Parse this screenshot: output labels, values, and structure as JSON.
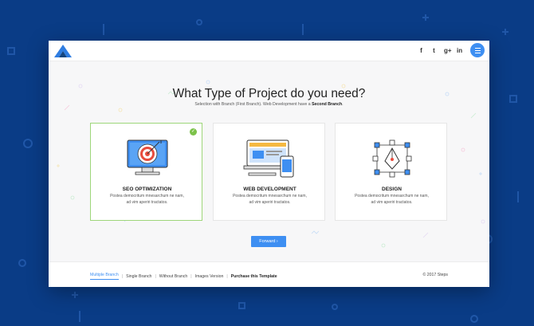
{
  "colors": {
    "background": "#0a3c86",
    "accent": "#3e8ff2",
    "selected_border": "#9ed67a",
    "check": "#7cc24a"
  },
  "header": {
    "logo_icon": "triangle-logo-icon",
    "social": [
      {
        "icon": "facebook-icon",
        "glyph": "f"
      },
      {
        "icon": "twitter-icon",
        "glyph": "t"
      },
      {
        "icon": "google-plus-icon",
        "glyph": "g+"
      },
      {
        "icon": "linkedin-icon",
        "glyph": "in"
      }
    ],
    "menu_icon": "hamburger-menu-icon"
  },
  "main": {
    "heading": "What Type of Project do you need?",
    "subtitle_prefix": "Selection with Branch (First Branch). Web Development have a ",
    "subtitle_bold": "Second Branch",
    "subtitle_suffix": ".",
    "cards": [
      {
        "title": "SEO OPTIMIZATION",
        "desc_line1": "Postea democritum mnesarchum ne nam,",
        "desc_line2": "ad vim aperiri tractatos.",
        "icon": "target-monitor-icon",
        "selected": true
      },
      {
        "title": "WEB DEVELOPMENT",
        "desc_line1": "Postea democritum mnesarchum ne nam,",
        "desc_line2": "ad vim aperiri tractatos.",
        "icon": "devices-icon",
        "selected": false
      },
      {
        "title": "DESIGN",
        "desc_line1": "Postea democritum mnesarchum ne nam,",
        "desc_line2": "ad vim aperiri tractatos.",
        "icon": "pen-tool-icon",
        "selected": false
      }
    ],
    "forward_label": "Forward",
    "forward_icon": "chevron-right-icon"
  },
  "footer": {
    "links": [
      "Multiple Branch",
      "Single Branch",
      "Without Branch",
      "Images Version",
      "Purchase this Template"
    ],
    "copyright": "© 2017 Steps"
  }
}
